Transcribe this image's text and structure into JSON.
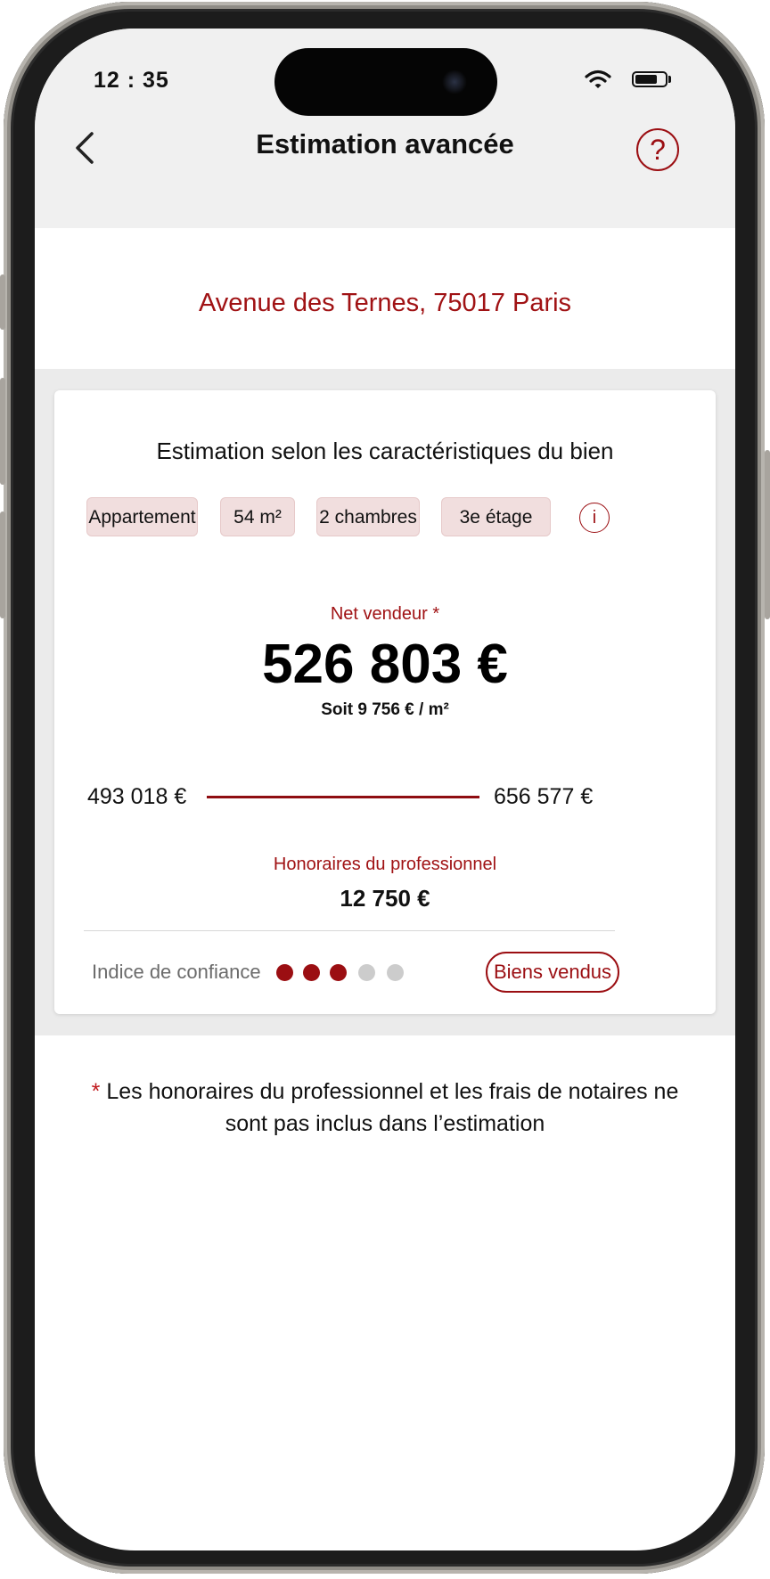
{
  "status_bar": {
    "time": "12 : 35",
    "icons": [
      "wifi-icon",
      "battery-icon"
    ],
    "battery_level": 0.75
  },
  "header": {
    "title": "Estimation avancée",
    "back_icon": "chevron-left-icon",
    "help_label": "?"
  },
  "address": "Avenue des Ternes, 75017 Paris",
  "estimate_card": {
    "title": "Estimation selon les caractéristiques du bien",
    "chips": [
      "Appartement",
      "54 m²",
      "2 chambres",
      "3e étage"
    ],
    "info_label": "i",
    "net_label": "Net vendeur *",
    "price": "526 803 €",
    "price_per_m2": "Soit 9 756 € / m²",
    "range": {
      "low": "493 018 €",
      "high": "656 577 €"
    },
    "fees_label": "Honoraires du professionnel",
    "fees_value": "12 750 €",
    "confidence": {
      "label": "Indice de confiance",
      "value": 3,
      "max": 5
    },
    "sold_button": "Biens vendus"
  },
  "footnote": {
    "star": "*",
    "text": "Les honoraires du professionnel et les frais de notaires ne sont pas inclus dans l’estimation"
  },
  "colors": {
    "accent": "#9b0e12",
    "chip_bg": "#f1dede",
    "dot_active": "#9b0e12",
    "dot_inactive": "#cccccc",
    "header_bg": "#f0f0f0"
  }
}
